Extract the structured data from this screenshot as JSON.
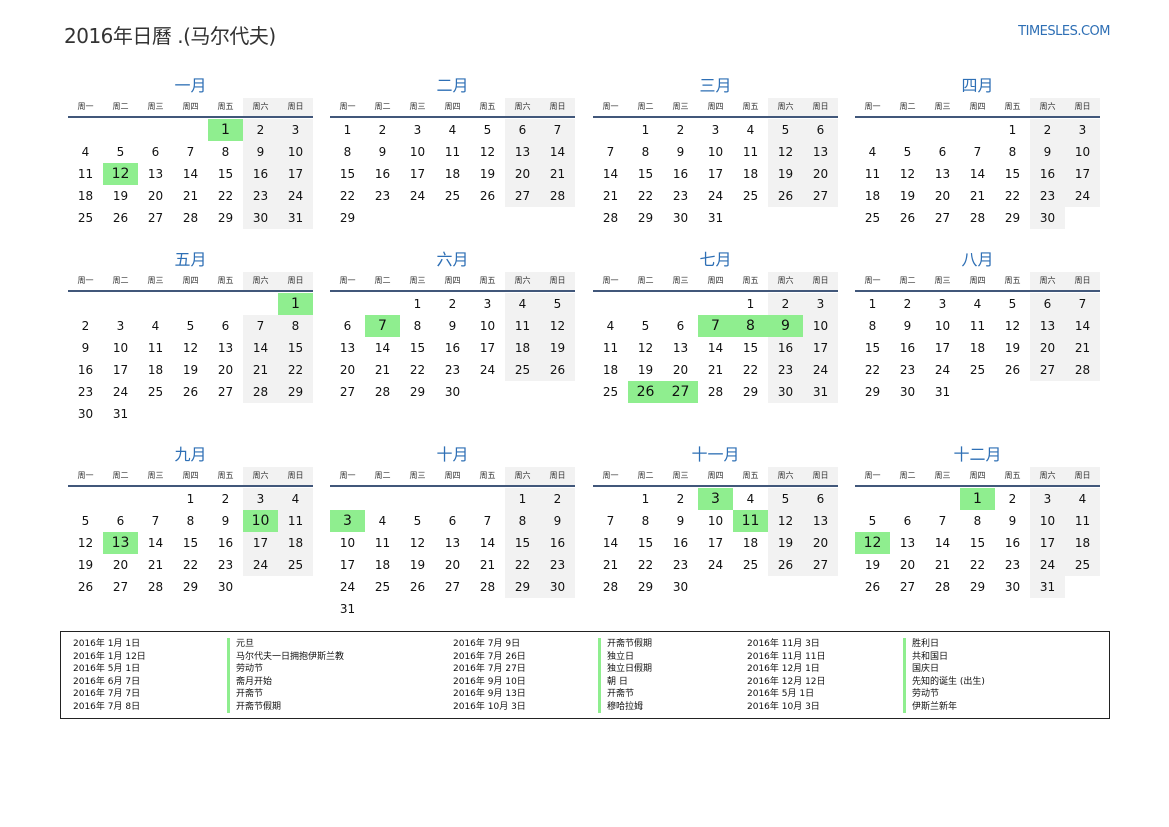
{
  "header": {
    "title": "2016年日曆 .(马尔代夫)",
    "site": "TIMESLES.COM"
  },
  "weekdays": [
    "周一",
    "周二",
    "周三",
    "周四",
    "周五",
    "周六",
    "周日"
  ],
  "months": [
    {
      "name": "一月",
      "offset": 4,
      "days": 31,
      "hol": [
        1,
        12
      ]
    },
    {
      "name": "二月",
      "offset": 0,
      "days": 29,
      "hol": []
    },
    {
      "name": "三月",
      "offset": 1,
      "days": 31,
      "hol": []
    },
    {
      "name": "四月",
      "offset": 4,
      "days": 30,
      "hol": []
    },
    {
      "name": "五月",
      "offset": 6,
      "days": 31,
      "hol": [
        1
      ]
    },
    {
      "name": "六月",
      "offset": 2,
      "days": 30,
      "hol": [
        7
      ]
    },
    {
      "name": "七月",
      "offset": 4,
      "days": 31,
      "hol": [
        7,
        8,
        9,
        26,
        27
      ]
    },
    {
      "name": "八月",
      "offset": 0,
      "days": 31,
      "hol": []
    },
    {
      "name": "九月",
      "offset": 3,
      "days": 30,
      "hol": [
        10,
        13
      ]
    },
    {
      "name": "十月",
      "offset": 5,
      "days": 31,
      "hol": [
        3
      ]
    },
    {
      "name": "十一月",
      "offset": 1,
      "days": 30,
      "hol": [
        3,
        11
      ]
    },
    {
      "name": "十二月",
      "offset": 3,
      "days": 31,
      "hol": [
        1,
        12
      ]
    }
  ],
  "holidays": [
    {
      "date": "2016年 1月 1日",
      "name": "元旦"
    },
    {
      "date": "2016年 1月 12日",
      "name": "马尔代夫一日拥抱伊斯兰教"
    },
    {
      "date": "2016年 5月 1日",
      "name": "劳动节"
    },
    {
      "date": "2016年 6月 7日",
      "name": "斋月开始"
    },
    {
      "date": "2016年 7月 7日",
      "name": "开斋节"
    },
    {
      "date": "2016年 7月 8日",
      "name": "开斋节假期"
    },
    {
      "date": "2016年 7月 9日",
      "name": "开斋节假期"
    },
    {
      "date": "2016年 7月 26日",
      "name": "独立日"
    },
    {
      "date": "2016年 7月 27日",
      "name": "独立日假期"
    },
    {
      "date": "2016年 9月 10日",
      "name": "朝 日"
    },
    {
      "date": "2016年 9月 13日",
      "name": "开斋节"
    },
    {
      "date": "2016年 10月 3日",
      "name": "穆哈拉姆"
    },
    {
      "date": "2016年 11月 3日",
      "name": "胜利日"
    },
    {
      "date": "2016年 11月 11日",
      "name": "共和国日"
    },
    {
      "date": "2016年 12月 1日",
      "name": "国庆日"
    },
    {
      "date": "2016年 12月 12日",
      "name": "先知的诞生 (出生)"
    },
    {
      "date": "2016年 5月 1日",
      "name": "劳动节"
    },
    {
      "date": "2016年 10月 3日",
      "name": "伊斯兰新年"
    }
  ]
}
